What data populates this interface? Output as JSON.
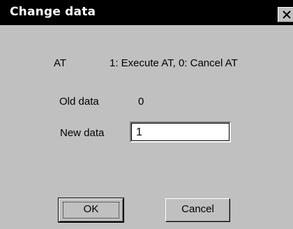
{
  "window": {
    "title": "Change data",
    "close_icon": "close-icon"
  },
  "at_row": {
    "label": "AT",
    "description": "1: Execute AT, 0: Cancel AT"
  },
  "old_data": {
    "label": "Old data",
    "value": "0"
  },
  "new_data": {
    "label": "New data",
    "value": "1"
  },
  "buttons": {
    "ok_label": "OK",
    "cancel_label": "Cancel"
  },
  "colors": {
    "dialog_bg": "#c0c0c0",
    "titlebar_bg": "#000000",
    "titlebar_text": "#ffffff",
    "input_bg": "#ffffff"
  }
}
